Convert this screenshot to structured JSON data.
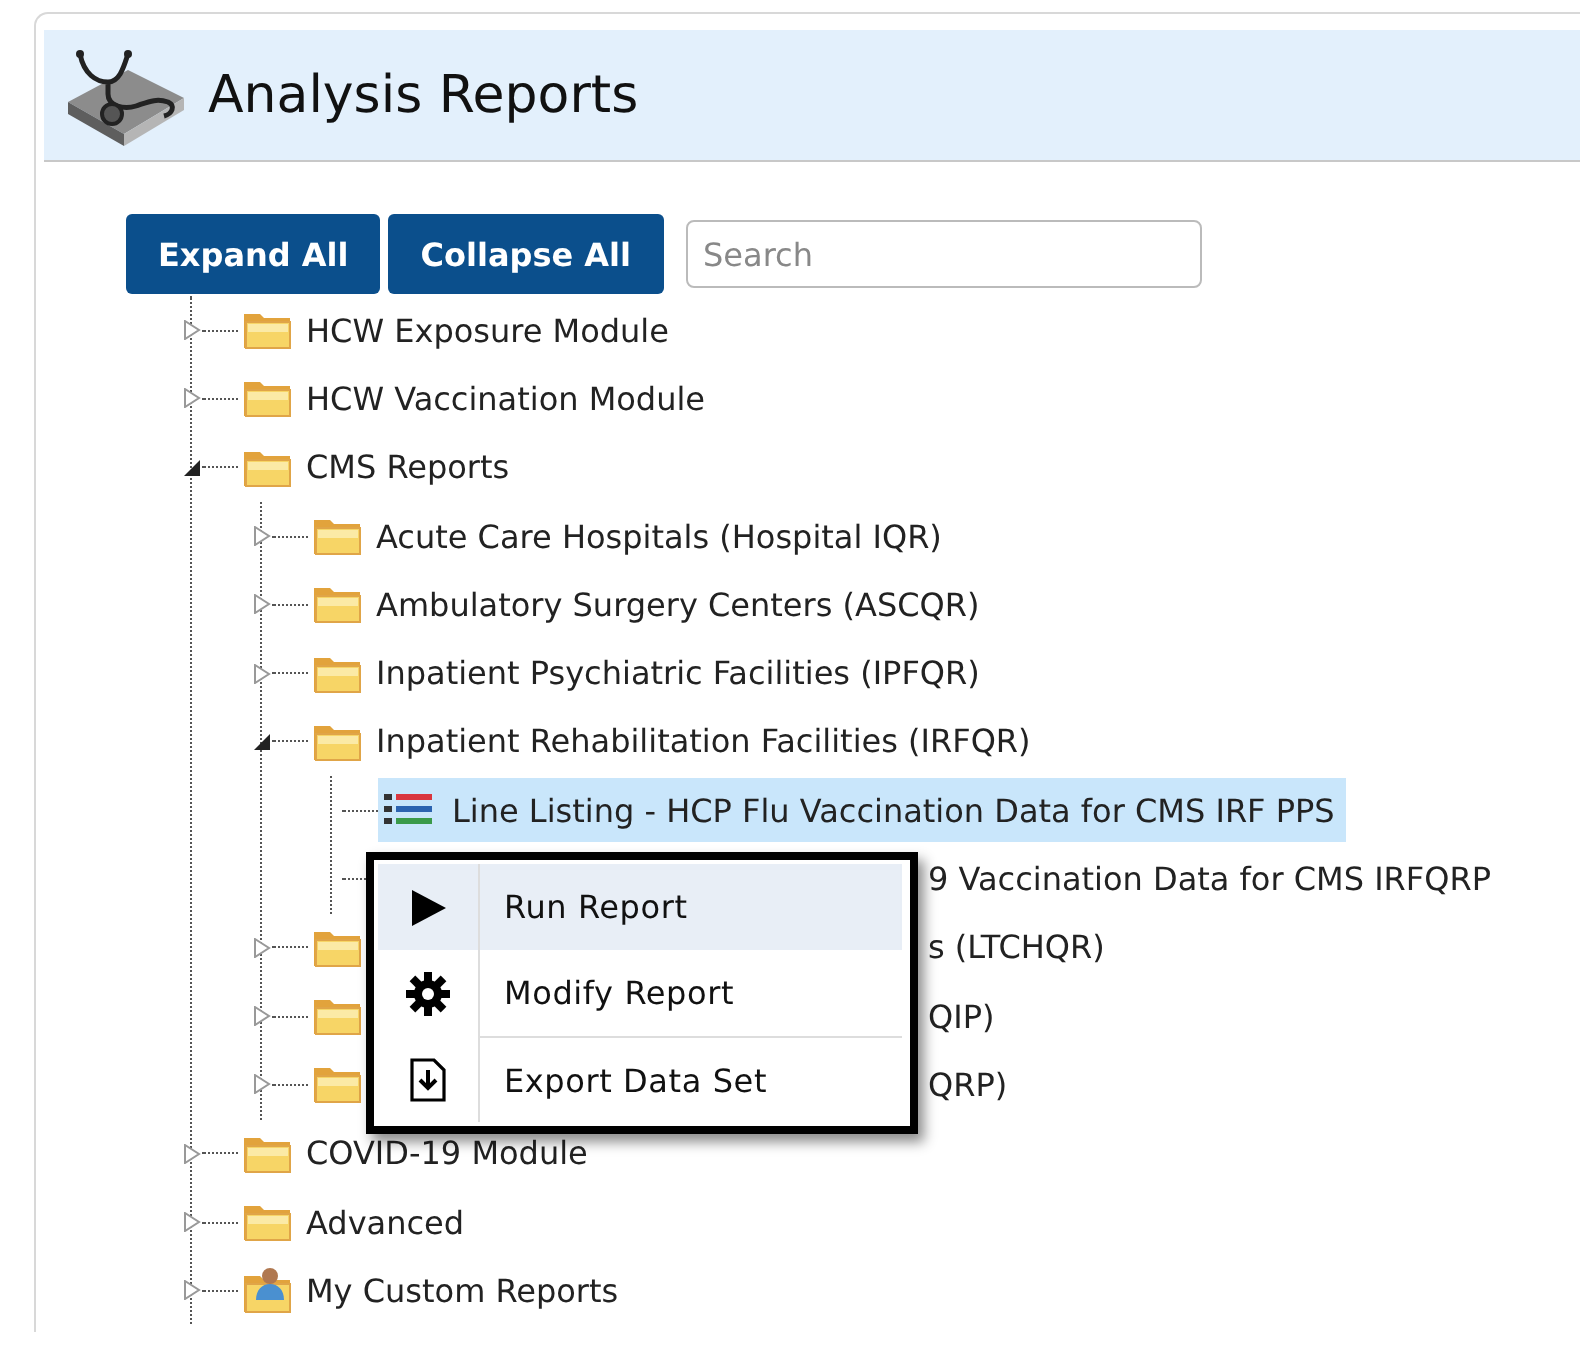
{
  "header": {
    "title": "Analysis Reports"
  },
  "toolbar": {
    "buttons": [
      "Expand All",
      "Collapse All"
    ],
    "search": {
      "placeholder": "Search"
    }
  },
  "tree": [
    {
      "kind": "folder",
      "label": "HCW Exposure Module",
      "expanded": false
    },
    {
      "kind": "folder",
      "label": "HCW Vaccination Module",
      "expanded": false
    },
    {
      "kind": "folder",
      "label": "CMS Reports",
      "expanded": true,
      "children": [
        {
          "kind": "folder",
          "label": "Acute Care Hospitals (Hospital IQR)",
          "expanded": false
        },
        {
          "kind": "folder",
          "label": "Ambulatory Surgery Centers (ASCQR)",
          "expanded": false
        },
        {
          "kind": "folder",
          "label": "Inpatient Psychiatric Facilities (IPFQR)",
          "expanded": false
        },
        {
          "kind": "folder",
          "label": "Inpatient Rehabilitation Facilities (IRFQR)",
          "expanded": true,
          "children": [
            {
              "kind": "report",
              "label": "Line Listing - HCP Flu Vaccination Data for CMS IRF PPS",
              "selected": true
            },
            {
              "kind": "report",
              "label": "9 Vaccination Data for CMS IRFQRP",
              "selected": false,
              "occluded": true
            }
          ]
        },
        {
          "kind": "folder",
          "label": "s (LTCHQR)",
          "expanded": false,
          "occluded": true
        },
        {
          "kind": "folder",
          "label": "QIP)",
          "expanded": false,
          "occluded": true
        },
        {
          "kind": "folder",
          "label": "QRP)",
          "expanded": false,
          "occluded": true
        }
      ]
    },
    {
      "kind": "folder",
      "label": "COVID-19 Module",
      "expanded": false
    },
    {
      "kind": "folder",
      "label": "Advanced",
      "expanded": false
    },
    {
      "kind": "custom_folder",
      "label": "My Custom Reports",
      "expanded": false
    }
  ],
  "context_menu": {
    "items": [
      {
        "kind": "run",
        "label": "Run Report",
        "selected": true
      },
      {
        "kind": "modify",
        "label": "Modify Report",
        "selected": false
      },
      {
        "kind": "export",
        "label": "Export Data Set",
        "selected": false
      }
    ]
  }
}
